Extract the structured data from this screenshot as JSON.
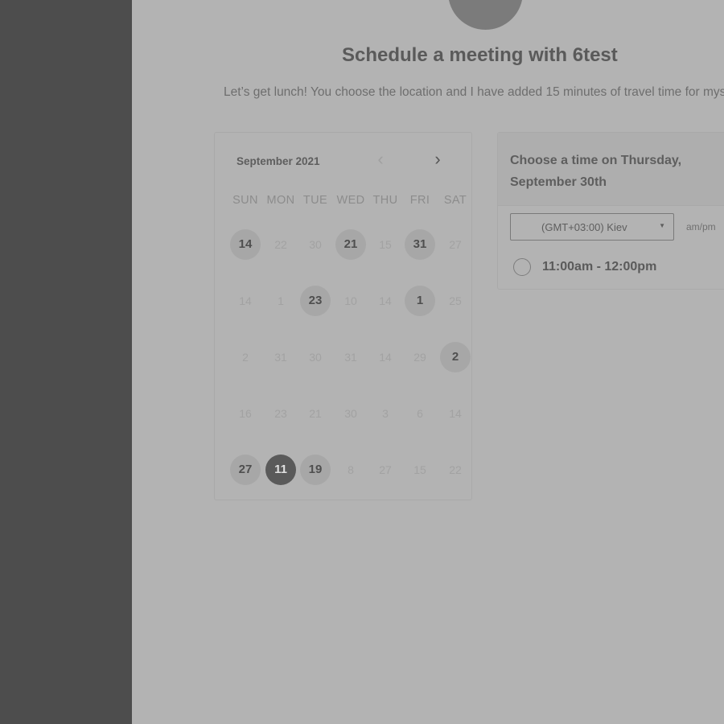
{
  "header": {
    "title": "Schedule a meeting with 6test",
    "description": "Let’s get lunch! You choose the location and I have added 15 minutes of travel time for mys"
  },
  "calendar": {
    "month_label": "September 2021",
    "prev_icon": "chevron-left-icon",
    "next_icon": "chevron-right-icon",
    "weekdays": [
      "SUN",
      "MON",
      "TUE",
      "WED",
      "THU",
      "FRI",
      "SAT"
    ],
    "weeks": [
      [
        {
          "d": "14",
          "s": "avail"
        },
        {
          "d": "22",
          "s": "off"
        },
        {
          "d": "30",
          "s": "off"
        },
        {
          "d": "21",
          "s": "avail"
        },
        {
          "d": "15",
          "s": "off"
        },
        {
          "d": "31",
          "s": "avail"
        },
        {
          "d": "27",
          "s": "off"
        }
      ],
      [
        {
          "d": "14",
          "s": "off"
        },
        {
          "d": "1",
          "s": "off"
        },
        {
          "d": "23",
          "s": "avail"
        },
        {
          "d": "10",
          "s": "off"
        },
        {
          "d": "14",
          "s": "off"
        },
        {
          "d": "1",
          "s": "avail"
        },
        {
          "d": "25",
          "s": "off"
        }
      ],
      [
        {
          "d": "2",
          "s": "off"
        },
        {
          "d": "31",
          "s": "off"
        },
        {
          "d": "30",
          "s": "off"
        },
        {
          "d": "31",
          "s": "off"
        },
        {
          "d": "14",
          "s": "off"
        },
        {
          "d": "29",
          "s": "off"
        },
        {
          "d": "2",
          "s": "avail"
        }
      ],
      [
        {
          "d": "16",
          "s": "off"
        },
        {
          "d": "23",
          "s": "off"
        },
        {
          "d": "21",
          "s": "off"
        },
        {
          "d": "30",
          "s": "off"
        },
        {
          "d": "3",
          "s": "off"
        },
        {
          "d": "6",
          "s": "off"
        },
        {
          "d": "14",
          "s": "off"
        }
      ],
      [
        {
          "d": "27",
          "s": "avail"
        },
        {
          "d": "11",
          "s": "sel"
        },
        {
          "d": "19",
          "s": "avail"
        },
        {
          "d": "8",
          "s": "off"
        },
        {
          "d": "27",
          "s": "off"
        },
        {
          "d": "15",
          "s": "off"
        },
        {
          "d": "22",
          "s": "off"
        }
      ]
    ]
  },
  "times": {
    "heading": "Choose a time on Thursday, September 30th",
    "timezone": "(GMT+03:00) Kiev",
    "format_label": "am/pm",
    "slots": [
      "11:00am - 12:00pm"
    ]
  },
  "colors": {
    "sidebar": "#4d4d4d",
    "background": "#b3b3b3",
    "selected_day": "#5a5a5a"
  }
}
